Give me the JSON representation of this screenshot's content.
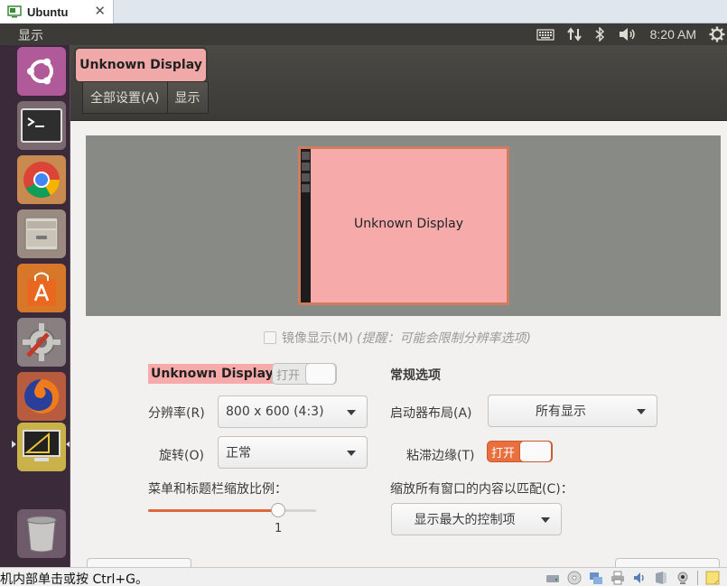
{
  "vm": {
    "tab_title": "Ubuntu",
    "tab_close": "✕",
    "status_hint": "机内部单击或按 Ctrl+G。"
  },
  "top_panel": {
    "app_title": "显示",
    "clock": "8:20 AM"
  },
  "launcher": {
    "items": [
      "ubuntu-dash",
      "terminal",
      "chrome",
      "files",
      "software-center",
      "system-settings",
      "firefox",
      "displays",
      "trash"
    ]
  },
  "window": {
    "ghost_title": "显示",
    "tooltip": "Unknown Display",
    "breadcrumbs": [
      "全部设置(A)",
      "显示"
    ]
  },
  "preview": {
    "monitor_label": "Unknown Display"
  },
  "mirror": {
    "label": "镜像显示(M)",
    "hint": "(提醒：可能会限制分辨率选项)"
  },
  "display": {
    "name": "Unknown Display",
    "switch_label": "打开",
    "switch_on": false,
    "resolution_label": "分辨率(R)",
    "resolution_value": "800 x 600 (4:3)",
    "rotation_label": "旋转(O)",
    "rotation_value": "正常",
    "scale_label": "菜单和标题栏缩放比例：",
    "scale_value": "1",
    "scale_level_pct": 77
  },
  "general": {
    "title": "常规选项",
    "launcher_layout_label": "启动器布局(A)",
    "launcher_layout_value": "所有显示",
    "sticky_edges_label": "粘滞边缘(T)",
    "sticky_switch_label": "打开",
    "sticky_on": true,
    "scale_all_label": "缩放所有窗口的内容以匹配(C)：",
    "scale_all_value": "显示最大的控制项"
  },
  "colors": {
    "accent": "#e96f3e",
    "display_highlight": "#f7aaaa",
    "launcher_bg": "#3a2a3a",
    "panel_bg": "#3c3b37"
  }
}
